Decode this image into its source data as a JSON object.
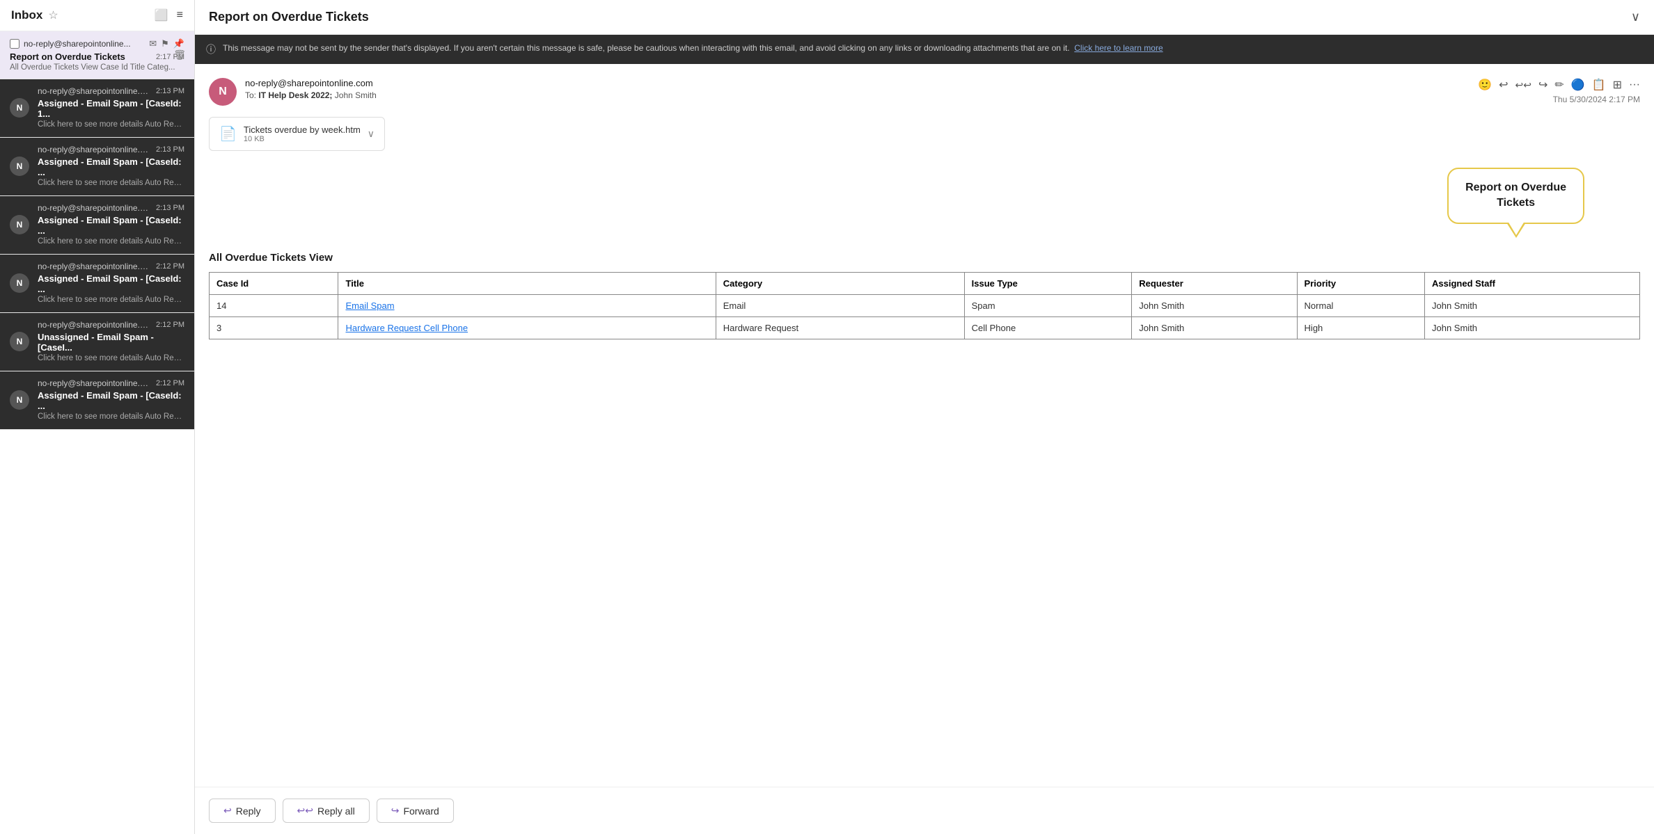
{
  "inbox": {
    "title": "Inbox",
    "star_icon": "☆",
    "icons": [
      "⬜",
      "≡"
    ],
    "emails": [
      {
        "id": "selected",
        "sender": "no-reply@sharepointonline...",
        "subject": "Report on Overdue Tickets",
        "time": "2:17 PM",
        "preview": "All Overdue Tickets View Case Id Title Categ...",
        "selected": true,
        "avatar": null,
        "icons": [
          "✉",
          "⚑",
          "📌"
        ]
      },
      {
        "id": "email2",
        "sender": "no-reply@sharepointonline.com",
        "subject": "Assigned - Email Spam - [CaseId: 1...",
        "time": "2:13 PM",
        "preview": "Click here to see more details Auto Reply on...",
        "selected": false,
        "avatar": "N"
      },
      {
        "id": "email3",
        "sender": "no-reply@sharepointonline.com",
        "subject": "Assigned - Email Spam - [CaseId: ...",
        "time": "2:13 PM",
        "preview": "Click here to see more details Auto Reply on...",
        "selected": false,
        "avatar": "N"
      },
      {
        "id": "email4",
        "sender": "no-reply@sharepointonline.com",
        "subject": "Assigned - Email Spam - [CaseId: ...",
        "time": "2:13 PM",
        "preview": "Click here to see more details Auto Reply on...",
        "selected": false,
        "avatar": "N"
      },
      {
        "id": "email5",
        "sender": "no-reply@sharepointonline.com",
        "subject": "Assigned - Email Spam - [CaseId: ...",
        "time": "2:12 PM",
        "preview": "Click here to see more details Auto Reply on...",
        "selected": false,
        "avatar": "N"
      },
      {
        "id": "email6",
        "sender": "no-reply@sharepointonline.com",
        "subject": "Unassigned - Email Spam - [CaseI...",
        "time": "2:12 PM",
        "preview": "Click here to see more details Auto Reply on...",
        "selected": false,
        "avatar": "N"
      },
      {
        "id": "email7",
        "sender": "no-reply@sharepointonline.com",
        "subject": "Assigned - Email Spam - [CaseId: ...",
        "time": "2:12 PM",
        "preview": "Click here to see more details Auto Reply on...",
        "selected": false,
        "avatar": "N"
      }
    ]
  },
  "detail": {
    "title": "Report on Overdue Tickets",
    "collapse_icon": "∨",
    "warning": {
      "text": "This message may not be sent by the sender that's displayed. If you aren't certain this message is safe, please be cautious when interacting with this email, and avoid clicking on any links or downloading attachments that are on it.",
      "learn_more": "Click here to learn more"
    },
    "sender_email": "no-reply@sharepointonline.com",
    "sender_avatar": "N",
    "to_label": "To:",
    "to_value": "IT Help Desk 2022;",
    "to_name": "John Smith",
    "date": "Thu 5/30/2024 2:17 PM",
    "toolbar_icons": [
      "🙂",
      "↩",
      "↩↩",
      "↪",
      "✏",
      "🔵",
      "📋",
      "⊞",
      "···"
    ],
    "attachment": {
      "name": "Tickets overdue by week.htm",
      "size": "10 KB",
      "icon": "📄"
    },
    "speech_bubble_text": "Report on Overdue\nTickets",
    "section_title": "All Overdue Tickets View",
    "table": {
      "headers": [
        "Case Id",
        "Title",
        "Category",
        "Issue Type",
        "Requester",
        "Priority",
        "Assigned Staff"
      ],
      "rows": [
        {
          "case_id": "14",
          "title": "Email Spam",
          "title_link": true,
          "category": "Email",
          "issue_type": "Spam",
          "requester": "John Smith",
          "priority": "Normal",
          "assigned_staff": "John Smith"
        },
        {
          "case_id": "3",
          "title": "Hardware Request Cell Phone",
          "title_link": true,
          "category": "Hardware Request",
          "issue_type": "Cell Phone",
          "requester": "John Smith",
          "priority": "High",
          "assigned_staff": "John Smith"
        }
      ]
    },
    "footer_buttons": [
      {
        "label": "Reply",
        "icon": "↩"
      },
      {
        "label": "Reply all",
        "icon": "↩↩"
      },
      {
        "label": "Forward",
        "icon": "↪"
      }
    ]
  }
}
